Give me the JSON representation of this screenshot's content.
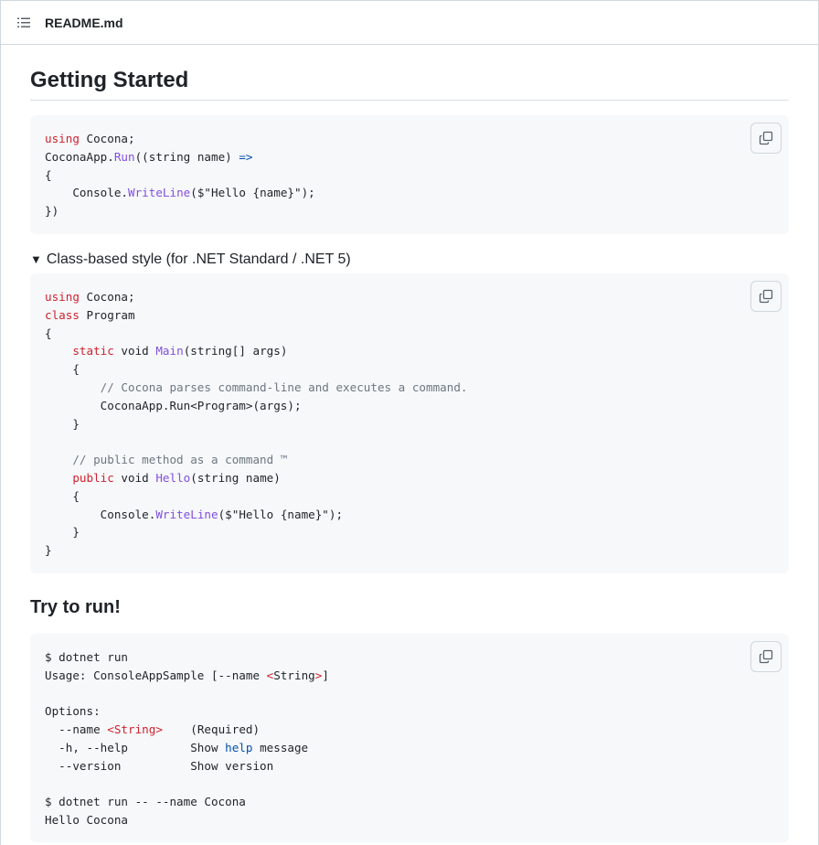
{
  "header": {
    "file_name": "README.md",
    "toc_icon": "list-unordered-icon"
  },
  "section1": {
    "heading": "Getting Started"
  },
  "code1": {
    "l1_kw": "using",
    "l1_rest": " Cocona;",
    "l2_a": "CoconaApp.",
    "l2_fn": "Run",
    "l2_b": "((string name) ",
    "l2_op": "=>",
    "l3": "{",
    "l4_a": "    Console.",
    "l4_fn": "WriteLine",
    "l4_b": "($\"Hello {name}\");",
    "l5": "})"
  },
  "details": {
    "summary": "Class-based style (for .NET Standard / .NET 5)",
    "marker": "▼"
  },
  "code2": {
    "l1_kw": "using",
    "l1_rest": " Cocona;",
    "l2_kw": "class",
    "l2_rest": " Program",
    "l3": "{",
    "l4_a": "    ",
    "l4_kw": "static",
    "l4_b": " void ",
    "l4_fn": "Main",
    "l4_c": "(string[] args)",
    "l5": "    {",
    "l6_cm": "        // Cocona parses command-line and executes a command.",
    "l7": "        CoconaApp.Run<Program>(args);",
    "l8": "    }",
    "l9": "",
    "l10_cm": "    // public method as a command ™",
    "l11_a": "    ",
    "l11_kw": "public",
    "l11_b": " void ",
    "l11_fn": "Hello",
    "l11_c": "(string name)",
    "l12": "    {",
    "l13_a": "        Console.",
    "l13_fn": "WriteLine",
    "l13_b": "($\"Hello {name}\");",
    "l14": "    }",
    "l15": "}"
  },
  "section2": {
    "heading": "Try to run!"
  },
  "code3": {
    "l1": "$ dotnet run",
    "l2_a": "Usage: ConsoleAppSample [--name ",
    "l2_tag_open": "<",
    "l2_tag_name": "String",
    "l2_tag_close": ">",
    "l2_b": "]",
    "l3": "",
    "l4": "Options:",
    "l5_a": "  --name ",
    "l5_tag": "<String>",
    "l5_b": "    (Required)",
    "l6_a": "  -h, --help         Show ",
    "l6_hl": "help",
    "l6_b": " message",
    "l7": "  --version          Show version",
    "l8": "",
    "l9": "$ dotnet run -- --name Cocona",
    "l10": "Hello Cocona"
  },
  "copy_button": {
    "icon": "copy-icon"
  }
}
